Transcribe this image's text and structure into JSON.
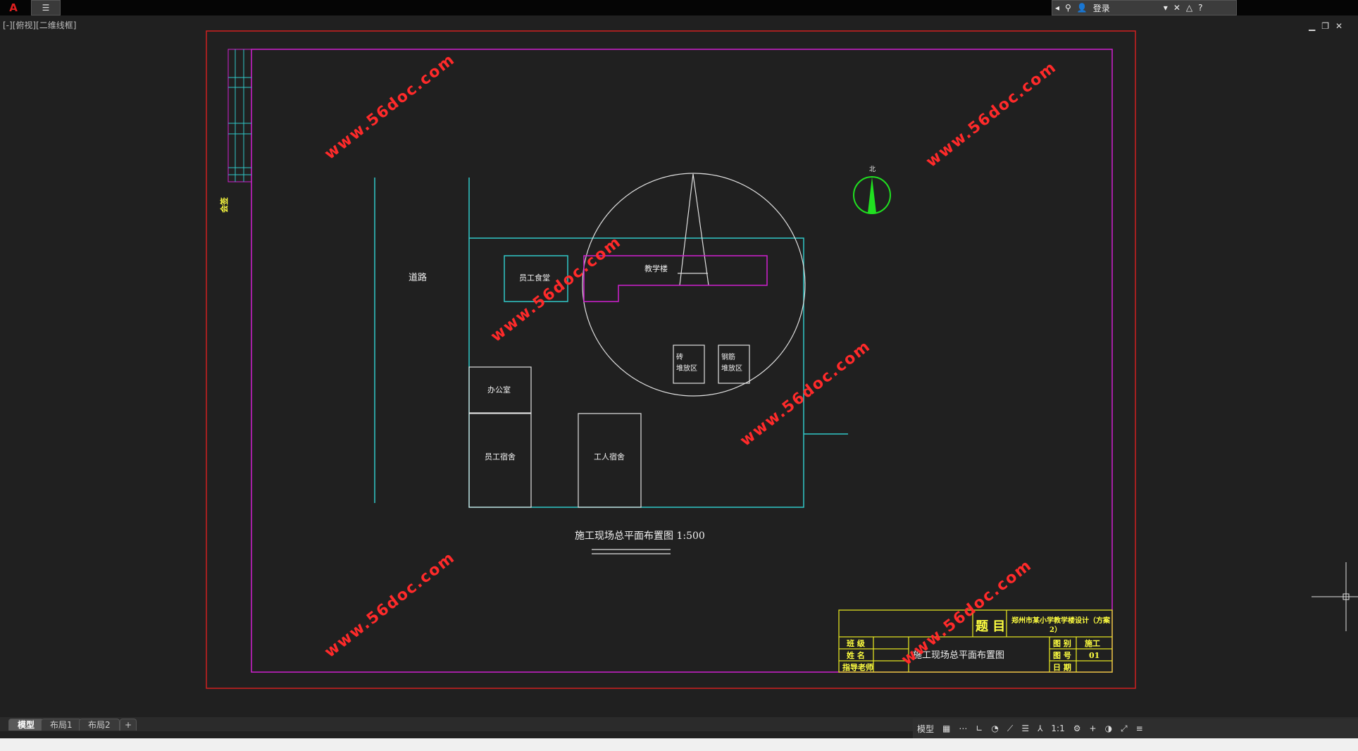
{
  "titlebar": {
    "logo": "A",
    "quick_access": "☰",
    "login_label": "登录"
  },
  "viewport_label": "[-][俯视][二维线框]",
  "drawing": {
    "road_label": "道路",
    "north_label": "北",
    "rooms": {
      "canteen": "员工食堂",
      "teaching": "教学楼",
      "office": "办公室",
      "staff_dorm": "员工宿舍",
      "worker_dorm": "工人宿舍",
      "material_1": "砖",
      "material_1b": "堆放区",
      "material_2": "钢筋",
      "material_2b": "堆放区"
    },
    "plan_title": "施工现场总平面布置图  1:500",
    "watermark": "www.56doc.com",
    "margin_note": "会签"
  },
  "title_block": {
    "topic_label": "题 目",
    "project_name": "郑州市某小学教学楼设计（方案",
    "project_name_2": "2）",
    "class_label": "班 级",
    "name_label": "姓 名",
    "advisor_label": "指导老师",
    "drawing_name": "施工现场总平面布置图",
    "category_label": "图 别",
    "category_value": "施工",
    "number_label": "图 号",
    "number_value": "01",
    "date_label": "日 期"
  },
  "layout_tabs": [
    "模型",
    "布局1",
    "布局2",
    "+"
  ],
  "status": {
    "model_label": "模型",
    "scale": "1:1"
  }
}
